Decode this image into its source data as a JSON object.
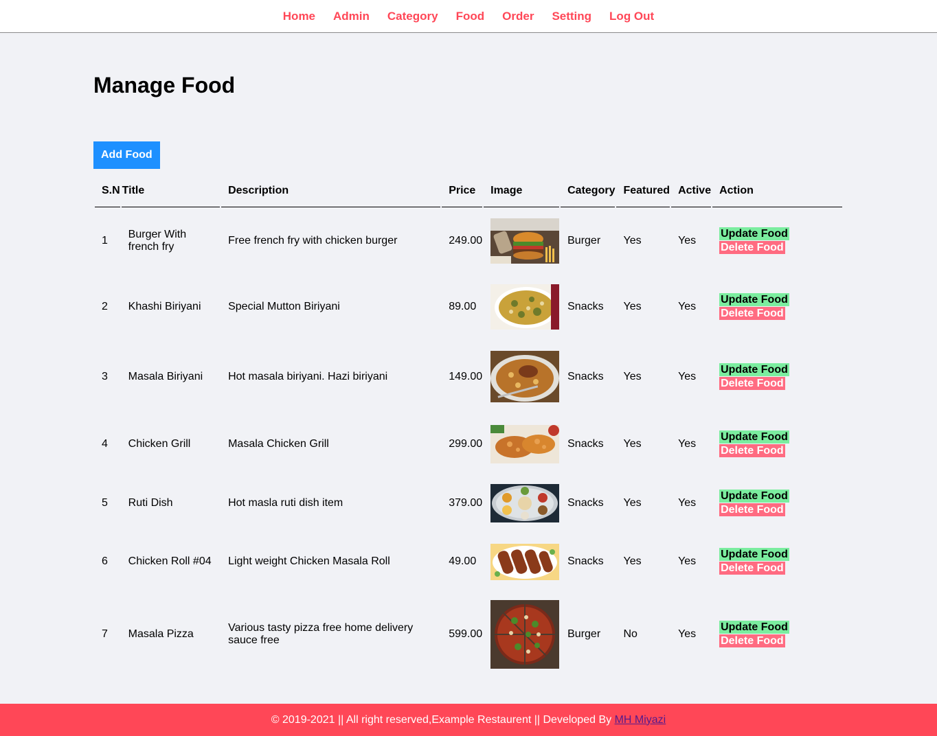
{
  "menu": {
    "items": [
      "Home",
      "Admin",
      "Category",
      "Food",
      "Order",
      "Setting",
      "Log Out"
    ]
  },
  "page": {
    "title": "Manage Food",
    "add_button": "Add Food"
  },
  "table": {
    "headers": {
      "sn": "S.N",
      "title": "Title",
      "description": "Description",
      "price": "Price",
      "image": "Image",
      "category": "Category",
      "featured": "Featured",
      "active": "Active",
      "action": "Action"
    },
    "update_label": "Update Food",
    "delete_label": "Delete Food",
    "rows": [
      {
        "sn": "1",
        "title": "Burger With french fry",
        "description": "Free french fry with chicken burger",
        "price": "249.00",
        "image": "burger-food-image",
        "category": "Burger",
        "featured": "Yes",
        "active": "Yes"
      },
      {
        "sn": "2",
        "title": "Khashi Biriyani",
        "description": "Special Mutton Biriyani",
        "price": "89.00",
        "image": "biriyani-food-image",
        "category": "Snacks",
        "featured": "Yes",
        "active": "Yes"
      },
      {
        "sn": "3",
        "title": "Masala Biriyani",
        "description": "Hot masala biriyani. Hazi biriyani",
        "price": "149.00",
        "image": "masala-biriyani-food-image",
        "category": "Snacks",
        "featured": "Yes",
        "active": "Yes"
      },
      {
        "sn": "4",
        "title": "Chicken Grill",
        "description": "Masala Chicken Grill",
        "price": "299.00",
        "image": "chicken-grill-food-image",
        "category": "Snacks",
        "featured": "Yes",
        "active": "Yes"
      },
      {
        "sn": "5",
        "title": "Ruti Dish",
        "description": "Hot masla ruti dish item",
        "price": "379.00",
        "image": "ruti-dish-food-image",
        "category": "Snacks",
        "featured": "Yes",
        "active": "Yes"
      },
      {
        "sn": "6",
        "title": "Chicken Roll #04",
        "description": "Light weight Chicken Masala Roll",
        "price": "49.00",
        "image": "chicken-roll-food-image",
        "category": "Snacks",
        "featured": "Yes",
        "active": "Yes"
      },
      {
        "sn": "7",
        "title": "Masala Pizza",
        "description": "Various tasty pizza free home delivery sauce free",
        "price": "599.00",
        "image": "pizza-food-image",
        "category": "Burger",
        "featured": "No",
        "active": "Yes"
      }
    ]
  },
  "footer": {
    "text": "© 2019-2021 || All right reserved,Example Restaurent || Developed By ",
    "link": "MH Miyazi"
  },
  "colors": {
    "accent": "#ff4757",
    "primary_button": "#1e90ff",
    "update_button": "#7bed9f",
    "delete_button": "#ff6b81",
    "background": "#f1f2f6"
  }
}
